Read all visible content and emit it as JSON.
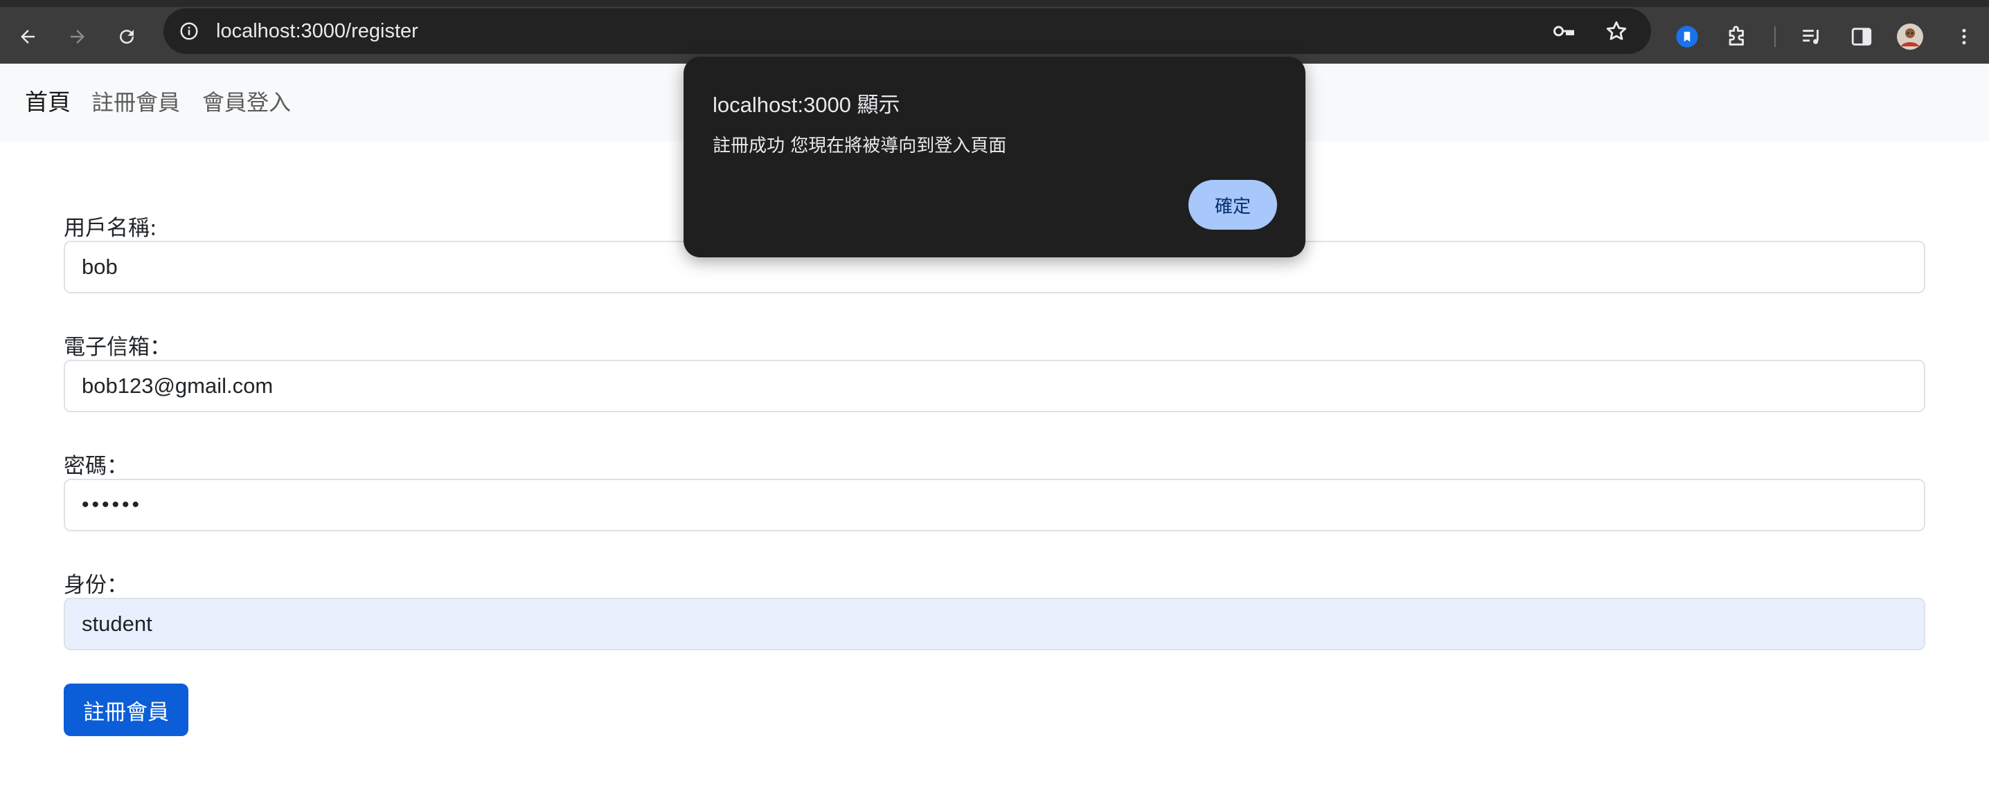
{
  "browser": {
    "url": "localhost:3000/register",
    "icons": {
      "back": "back-arrow-icon",
      "forward": "forward-arrow-icon",
      "reload": "reload-icon",
      "site_info": "info-icon",
      "password": "key-icon",
      "bookmark": "star-icon",
      "extension_bookmark": "bookmark-extension-icon",
      "extensions": "puzzle-icon",
      "media": "media-queue-icon",
      "side_panel": "side-panel-icon",
      "profile": "avatar",
      "menu": "kebab-menu-icon"
    },
    "accent": "#1a73e8"
  },
  "nav": {
    "brand": "首頁",
    "links": [
      "註冊會員",
      "會員登入"
    ]
  },
  "form": {
    "username_label": "用戶名稱:",
    "username_value": "bob",
    "email_label": "電子信箱：",
    "email_value": "bob123@gmail.com",
    "password_label": "密碼：",
    "password_value": "••••••",
    "role_label": "身份：",
    "role_value": "student",
    "submit_label": "註冊會員",
    "submit_color": "#0b5ed7"
  },
  "dialog": {
    "title": "localhost:3000 顯示",
    "message": "註冊成功 您現在將被導向到登入頁面",
    "ok_label": "確定",
    "ok_color": "#a8c7fa"
  }
}
